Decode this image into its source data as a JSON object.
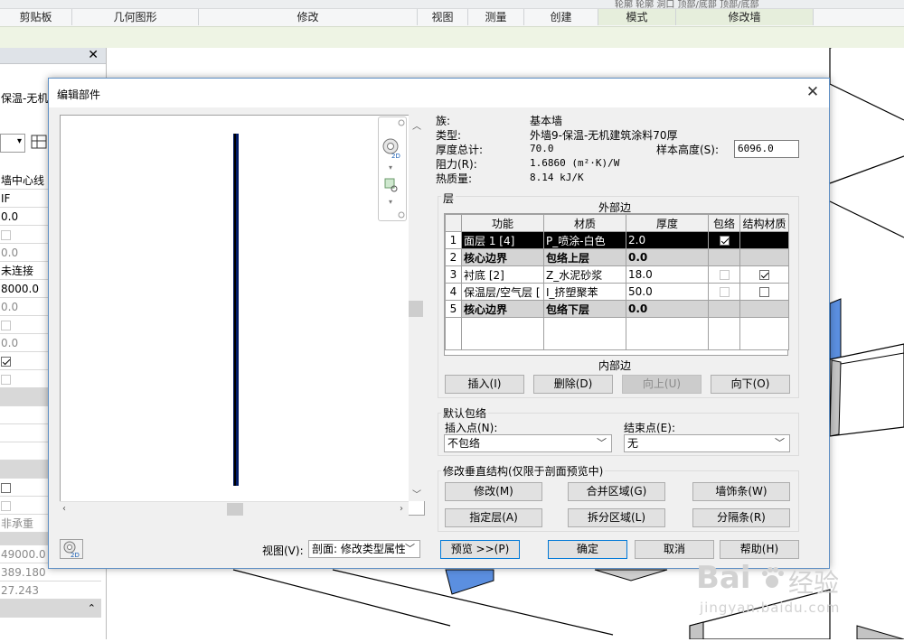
{
  "ribbon": {
    "groups": [
      "剪贴板",
      "几何图形",
      "修改",
      "视图",
      "测量",
      "创建",
      "模式",
      "修改墙"
    ],
    "top_labels": "轮廓  轮廓   洞口  顶部/底部 顶部/底部"
  },
  "props": {
    "family_text": "保温-无机建",
    "rows": [
      "墙中心线",
      "IF",
      "0.0",
      "",
      "0.0",
      "未连接",
      "8000.0",
      "0.0",
      "",
      "0.0",
      "",
      "",
      "",
      "",
      "",
      "",
      "非承重",
      "49000.0",
      "389.180",
      "27.243"
    ]
  },
  "dialog": {
    "title": "编辑部件",
    "info": {
      "family_label": "族:",
      "family_value": "基本墙",
      "type_label": "类型:",
      "type_value": "外墙9-保温-无机建筑涂料70厚",
      "thickness_label": "厚度总计:",
      "thickness_value": "70.0",
      "resistance_label": "阻力(R):",
      "resistance_value": "1.6860 (m²·K)/W",
      "thermal_label": "热质量:",
      "thermal_value": "8.14 kJ/K",
      "sample_height_label": "样本高度(S):",
      "sample_height_value": "6096.0"
    },
    "layers": {
      "group_title": "层",
      "exterior_label": "外部边",
      "interior_label": "内部边",
      "headers": [
        "功能",
        "材质",
        "厚度",
        "包络",
        "结构材质"
      ],
      "rows": [
        {
          "num": "1",
          "function": "面层 1 [4]",
          "material": "P_喷涂-白色",
          "thickness": "2.0"
        },
        {
          "num": "2",
          "function": "核心边界",
          "material": "包络上层",
          "thickness": "0.0"
        },
        {
          "num": "3",
          "function": "衬底 [2]",
          "material": "Z_水泥砂浆",
          "thickness": "18.0"
        },
        {
          "num": "4",
          "function": "保温层/空气层 [",
          "material": "I_挤塑聚苯",
          "thickness": "50.0"
        },
        {
          "num": "5",
          "function": "核心边界",
          "material": "包络下层",
          "thickness": "0.0"
        }
      ],
      "buttons": {
        "insert": "插入(I)",
        "delete": "删除(D)",
        "up": "向上(U)",
        "down": "向下(O)"
      }
    },
    "wrapping": {
      "title": "默认包络",
      "insert_label": "插入点(N):",
      "insert_value": "不包络",
      "end_label": "结束点(E):",
      "end_value": "无"
    },
    "vertical": {
      "title": "修改垂直结构(仅限于剖面预览中)",
      "modify": "修改(M)",
      "merge": "合并区域(G)",
      "sweeps": "墙饰条(W)",
      "assign": "指定层(A)",
      "split": "拆分区域(L)",
      "reveals": "分隔条(R)"
    },
    "footer": {
      "view_label": "视图(V):",
      "view_value": "剖面: 修改类型属性",
      "preview": "预览 >>(P)",
      "ok": "确定",
      "cancel": "取消",
      "help": "帮助(H)"
    }
  },
  "watermark": {
    "brand": "Bai",
    "brand2": "经验",
    "url": "jingyan.baidu.com"
  },
  "colors": {
    "accent": "#0078d7",
    "ribbon_mode": "#e6eedc",
    "selection": "#000000",
    "wall_blue": "#5b8fe0"
  }
}
